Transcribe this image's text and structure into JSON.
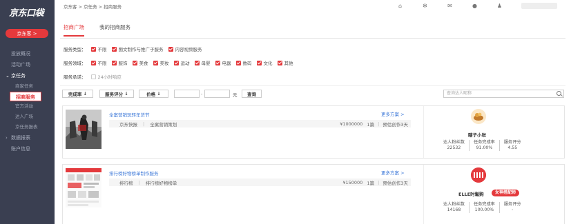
{
  "sidebar": {
    "logo": "京东口袋",
    "account_button": "京东客 >",
    "items": [
      {
        "label": "投放概况"
      },
      {
        "label": "活动广场"
      },
      {
        "label": "京任务"
      },
      {
        "label": "商家任务"
      },
      {
        "label": "招商服务"
      },
      {
        "label": "官方活动"
      },
      {
        "label": "达人广场"
      },
      {
        "label": "京任务报表"
      },
      {
        "label": "数据报表"
      },
      {
        "label": "账户信息"
      }
    ]
  },
  "header": {
    "breadcrumb": "京东客 > 京任务 > 招商服务"
  },
  "tabs": [
    {
      "label": "招商广场"
    },
    {
      "label": "我的招商服务"
    }
  ],
  "filters": {
    "service_type": {
      "label": "服务类型：",
      "options": [
        "不限",
        "图文制作与推广子服务",
        "内容视频服务"
      ]
    },
    "service_field": {
      "label": "服务领域：",
      "options": [
        "不限",
        "服饰",
        "美食",
        "美妆",
        "运动",
        "母婴",
        "电器",
        "数码",
        "文化",
        "其他"
      ]
    },
    "service_promise": {
      "label": "服务承诺：",
      "options": [
        "24小时响应"
      ]
    }
  },
  "sortbar": {
    "sort_completion": "完成率",
    "sort_rating": "服务评分",
    "sort_price": "价格",
    "unit": "元",
    "query_button": "查询",
    "search_placeholder": "查询达人昵称"
  },
  "cards": [
    {
      "title": "全案营销玩转年货节",
      "category": "京东快报",
      "service": "全案营销策划",
      "price": "¥1000000",
      "qty": "1篇",
      "delivery": "预估创作3天",
      "more": "更多方案 >",
      "talent_name": "瞎子小张",
      "fans_label": "达人粉丝数",
      "fans": "22532",
      "completion_label": "任务完成率",
      "completion": "91.00%",
      "rating_label": "服务评分",
      "rating": "4.55"
    },
    {
      "title": "排行榜好物榜单制作服务",
      "category": "排行榜",
      "service": "排行榜好物榜单",
      "price": "¥150000",
      "qty": "1篇",
      "delivery": "预估创作3天",
      "more": "更多方案 >",
      "talent_name": "ELLE时髦购",
      "badge": "女神搭配师",
      "fans_label": "达人粉丝数",
      "fans": "14168",
      "completion_label": "任务完成率",
      "completion": "100.00%",
      "rating_label": "服务评分",
      "rating": "-"
    }
  ],
  "colors": {
    "accent": "#e4393c",
    "sidebar": "#3a3f51",
    "link": "#3c78d8"
  }
}
